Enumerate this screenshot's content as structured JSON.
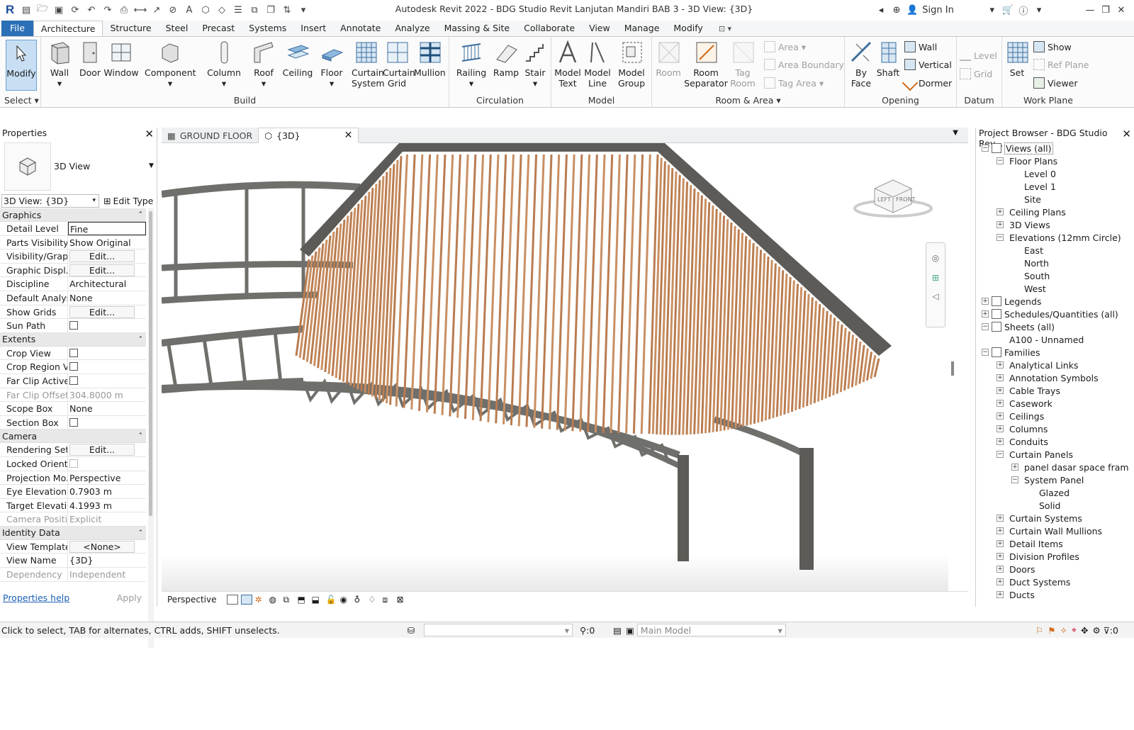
{
  "app": {
    "title": "Autodesk Revit 2022 - BDG Studio Revit Lanjutan Mandiri BAB 3 - 3D View: {3D}",
    "sign_in": "Sign In",
    "logo": "R"
  },
  "ribbon_tabs": [
    "File",
    "Architecture",
    "Structure",
    "Steel",
    "Precast",
    "Systems",
    "Insert",
    "Annotate",
    "Analyze",
    "Massing & Site",
    "Collaborate",
    "View",
    "Manage",
    "Modify"
  ],
  "ribbon": {
    "select": {
      "modify": "Modify",
      "label": "Select"
    },
    "build": {
      "label": "Build",
      "tools": [
        "Wall",
        "Door",
        "Window",
        "Component",
        "Column",
        "Roof",
        "Ceiling",
        "Floor",
        "Curtain System",
        "Curtain Grid",
        "Mullion"
      ]
    },
    "circulation": {
      "label": "Circulation",
      "tools": [
        "Railing",
        "Ramp",
        "Stair"
      ]
    },
    "model": {
      "label": "Model",
      "tools": [
        "Model Text",
        "Model Line",
        "Model Group"
      ]
    },
    "room_area": {
      "label": "Room & Area",
      "tools": [
        "Room",
        "Room Separator",
        "Tag Room"
      ],
      "small": [
        "Area",
        "Area Boundary",
        "Tag Area"
      ]
    },
    "opening": {
      "label": "Opening",
      "tools": [
        "By Face",
        "Shaft"
      ],
      "small": [
        "Wall",
        "Vertical",
        "Dormer"
      ]
    },
    "datum": {
      "label": "Datum",
      "small": [
        "Level",
        "Grid"
      ]
    },
    "work_plane": {
      "label": "Work Plane",
      "tools": [
        "Set"
      ],
      "small": [
        "Show",
        "Ref Plane",
        "Viewer"
      ]
    }
  },
  "properties": {
    "title": "Properties",
    "type_name": "3D View",
    "selector": "3D View: {3D}",
    "edit_type": "Edit Type",
    "sections": [
      {
        "name": "Graphics",
        "rows": [
          {
            "k": "Detail Level",
            "v": "Fine",
            "kind": "active"
          },
          {
            "k": "Parts Visibility",
            "v": "Show Original",
            "kind": "text"
          },
          {
            "k": "Visibility/Grap...",
            "v": "Edit...",
            "kind": "button"
          },
          {
            "k": "Graphic Displ...",
            "v": "Edit...",
            "kind": "button"
          },
          {
            "k": "Discipline",
            "v": "Architectural",
            "kind": "text"
          },
          {
            "k": "Default Analys...",
            "v": "None",
            "kind": "text"
          },
          {
            "k": "Show Grids",
            "v": "Edit...",
            "kind": "button"
          },
          {
            "k": "Sun Path",
            "v": "",
            "kind": "check"
          }
        ]
      },
      {
        "name": "Extents",
        "rows": [
          {
            "k": "Crop View",
            "v": "",
            "kind": "check"
          },
          {
            "k": "Crop Region V...",
            "v": "",
            "kind": "check"
          },
          {
            "k": "Far Clip Active",
            "v": "",
            "kind": "check"
          },
          {
            "k": "Far Clip Offset",
            "v": "304.8000 m",
            "kind": "disabled"
          },
          {
            "k": "Scope Box",
            "v": "None",
            "kind": "text"
          },
          {
            "k": "Section Box",
            "v": "",
            "kind": "check"
          }
        ]
      },
      {
        "name": "Camera",
        "rows": [
          {
            "k": "Rendering Set...",
            "v": "Edit...",
            "kind": "button"
          },
          {
            "k": "Locked Orient...",
            "v": "",
            "kind": "check-disabled"
          },
          {
            "k": "Projection Mo...",
            "v": "Perspective",
            "kind": "text"
          },
          {
            "k": "Eye Elevation",
            "v": "0.7903 m",
            "kind": "text"
          },
          {
            "k": "Target Elevati...",
            "v": "4.1993 m",
            "kind": "text"
          },
          {
            "k": "Camera Positi...",
            "v": "Explicit",
            "kind": "disabled"
          }
        ]
      },
      {
        "name": "Identity Data",
        "rows": [
          {
            "k": "View Template",
            "v": "<None>",
            "kind": "button"
          },
          {
            "k": "View Name",
            "v": "{3D}",
            "kind": "text"
          },
          {
            "k": "Dependency",
            "v": "Independent",
            "kind": "disabled"
          }
        ]
      }
    ],
    "help": "Properties help",
    "apply": "Apply"
  },
  "view_tabs": [
    {
      "label": "GROUND FLOOR",
      "active": false
    },
    {
      "label": "{3D}",
      "active": true
    }
  ],
  "view_cube": {
    "left": "LEFT",
    "front": "FRONT"
  },
  "view_control_bar": {
    "projection": "Perspective"
  },
  "project_browser": {
    "title": "Project Browser - BDG Studio Rev...",
    "items": [
      {
        "label": "Views (all)",
        "level": 0,
        "box": "−",
        "icon": true,
        "selected": true
      },
      {
        "label": "Floor Plans",
        "level": 1,
        "box": "−"
      },
      {
        "label": "Level 0",
        "level": 2,
        "box": ""
      },
      {
        "label": "Level 1",
        "level": 2,
        "box": ""
      },
      {
        "label": "Site",
        "level": 2,
        "box": ""
      },
      {
        "label": "Ceiling Plans",
        "level": 1,
        "box": "+"
      },
      {
        "label": "3D Views",
        "level": 1,
        "box": "+"
      },
      {
        "label": "Elevations (12mm Circle)",
        "level": 1,
        "box": "−"
      },
      {
        "label": "East",
        "level": 2,
        "box": ""
      },
      {
        "label": "North",
        "level": 2,
        "box": ""
      },
      {
        "label": "South",
        "level": 2,
        "box": ""
      },
      {
        "label": "West",
        "level": 2,
        "box": ""
      },
      {
        "label": "Legends",
        "level": 0,
        "box": "+",
        "icon": true
      },
      {
        "label": "Schedules/Quantities (all)",
        "level": 0,
        "box": "+",
        "icon": true
      },
      {
        "label": "Sheets (all)",
        "level": 0,
        "box": "−",
        "icon": true
      },
      {
        "label": "A100 - Unnamed",
        "level": 1,
        "box": ""
      },
      {
        "label": "Families",
        "level": 0,
        "box": "−",
        "icon": true
      },
      {
        "label": "Analytical Links",
        "level": 1,
        "box": "+"
      },
      {
        "label": "Annotation Symbols",
        "level": 1,
        "box": "+"
      },
      {
        "label": "Cable Trays",
        "level": 1,
        "box": "+"
      },
      {
        "label": "Casework",
        "level": 1,
        "box": "+"
      },
      {
        "label": "Ceilings",
        "level": 1,
        "box": "+"
      },
      {
        "label": "Columns",
        "level": 1,
        "box": "+"
      },
      {
        "label": "Conduits",
        "level": 1,
        "box": "+"
      },
      {
        "label": "Curtain Panels",
        "level": 1,
        "box": "−"
      },
      {
        "label": "panel dasar space fram",
        "level": 2,
        "box": "+"
      },
      {
        "label": "System Panel",
        "level": 2,
        "box": "−"
      },
      {
        "label": "Glazed",
        "level": 3,
        "box": ""
      },
      {
        "label": "Solid",
        "level": 3,
        "box": ""
      },
      {
        "label": "Curtain Systems",
        "level": 1,
        "box": "+"
      },
      {
        "label": "Curtain Wall Mullions",
        "level": 1,
        "box": "+"
      },
      {
        "label": "Detail Items",
        "level": 1,
        "box": "+"
      },
      {
        "label": "Division Profiles",
        "level": 1,
        "box": "+"
      },
      {
        "label": "Doors",
        "level": 1,
        "box": "+"
      },
      {
        "label": "Duct Systems",
        "level": 1,
        "box": "+"
      },
      {
        "label": "Ducts",
        "level": 1,
        "box": "+"
      }
    ]
  },
  "status": {
    "message": "Click to select, TAB for alternates, CTRL adds, SHIFT unselects.",
    "count": ":0",
    "model": "Main Model",
    "filter": ":0"
  },
  "colors": {
    "accent": "#2b6fb6",
    "louver": "#c98f62",
    "truss": "#6f6f6b",
    "roof_edge": "#5d5b57"
  }
}
